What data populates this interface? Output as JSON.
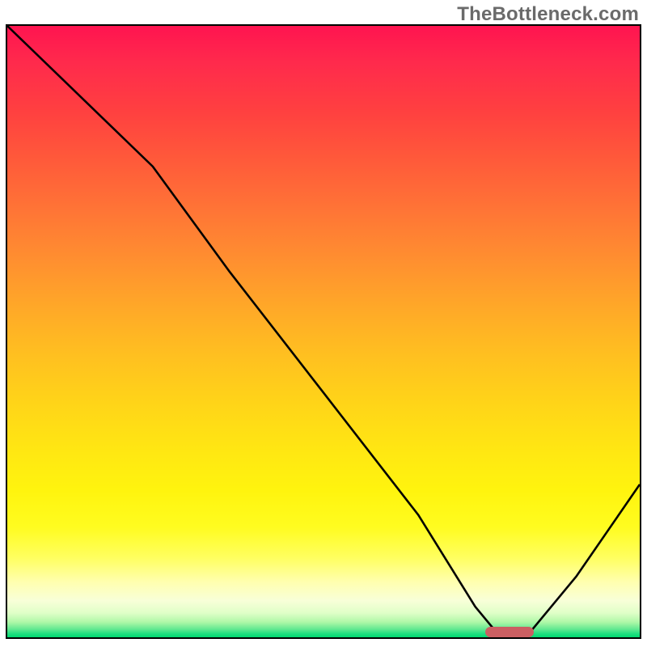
{
  "watermark": "TheBottleneck.com",
  "chart_data": {
    "type": "line",
    "title": "",
    "xlabel": "",
    "ylabel": "",
    "xlim": [
      0,
      100
    ],
    "ylim": [
      0,
      100
    ],
    "grid": false,
    "legend": false,
    "series": [
      {
        "name": "bottleneck-curve",
        "x": [
          0,
          10,
          23,
          35,
          50,
          65,
          74,
          78,
          82,
          90,
          100
        ],
        "y": [
          100,
          90,
          77,
          60,
          40,
          20,
          5,
          0,
          0,
          10,
          25
        ]
      }
    ],
    "marker": {
      "x_center": 79,
      "y": 0,
      "width_pct": 7.6
    },
    "background": {
      "type": "vertical-gradient",
      "stops": [
        {
          "pct": 0,
          "color": "#ff1450"
        },
        {
          "pct": 50,
          "color": "#ffc020"
        },
        {
          "pct": 85,
          "color": "#ffff90"
        },
        {
          "pct": 100,
          "color": "#00d870"
        }
      ]
    }
  }
}
